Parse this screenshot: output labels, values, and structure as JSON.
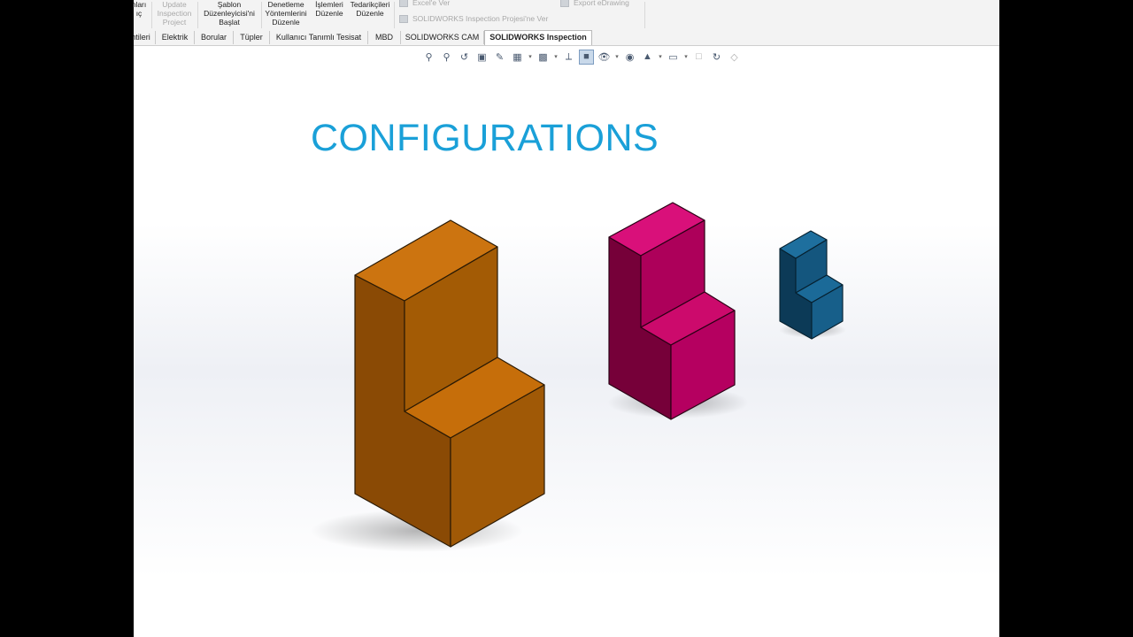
{
  "ribbon": {
    "partial_left": "nları\nıç",
    "update_project": "Update\nInspection\nProject",
    "template_editor": "Şablon\nDüzenleyicisi'ni\nBaşlat",
    "edit_methods": "Denetleme\nYöntemlerini\nDüzenle",
    "edit_operations": "İşlemleri\nDüzenle",
    "edit_vendors": "Tedarikçileri\nDüzenle",
    "export_excel": "Excel'e Ver",
    "export_project": "SOLIDWORKS Inspection Projesi'ne Ver",
    "export_edrawing": "Export eDrawing"
  },
  "tabs": [
    {
      "label": "ntileri"
    },
    {
      "label": "Elektrik"
    },
    {
      "label": "Borular"
    },
    {
      "label": "Tüpler"
    },
    {
      "label": "Kullanıcı Tanımlı Tesisat"
    },
    {
      "label": "MBD"
    },
    {
      "label": "SOLIDWORKS CAM"
    },
    {
      "label": "SOLIDWORKS Inspection"
    }
  ],
  "active_tab": "SOLIDWORKS Inspection",
  "heads_up_toolbar": [
    "zoom-to-fit-icon",
    "zoom-to-area-icon",
    "previous-view-icon",
    "section-view-icon",
    "dynamic-annotation-icon",
    "view-orientation-icon",
    "display-style-icon",
    "view-planes-icon",
    "shaded-cube-icon",
    "hide-show-icon",
    "edit-appearance-icon",
    "apply-scene-icon",
    "view-settings-icon",
    "sheet-icon",
    "rotate-icon",
    "realview-icon"
  ],
  "viewport_title": "CONFIGURATIONS",
  "colors": {
    "title": "#1aa0d8",
    "orange_part": "#c06a08",
    "magenta_part": "#c90068",
    "blue_part": "#14628f"
  }
}
